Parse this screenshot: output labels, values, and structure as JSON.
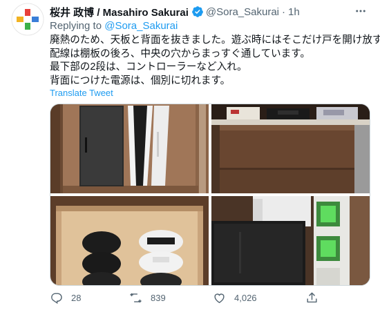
{
  "tweet": {
    "author_name": "桜井 政博 / Masahiro Sakurai",
    "handle": "@Sora_Sakurai",
    "separator": "·",
    "time": "1h",
    "reply_prefix": "Replying to",
    "reply_to": "@Sora_Sakurai",
    "body_lines": [
      "廃熱のため、天板と背面を抜きました。遊ぶ時にはそこだけ戸を開け放す。",
      "配線は棚板の後ろ、中央の穴からまっすぐ通しています。",
      "最下部の2段は、コントローラーなど入れ。",
      "背面につけた電源は、個別に切れます。"
    ],
    "translate_label": "Translate Tweet"
  },
  "actions": {
    "replies": "28",
    "retweets": "839",
    "likes": "4,026"
  },
  "colors": {
    "accent": "#1d9bf0",
    "secondary_text": "#536471"
  },
  "icons": [
    "avatar-logo",
    "verified-icon",
    "more-icon",
    "reply-icon",
    "retweet-icon",
    "like-icon",
    "share-icon"
  ]
}
